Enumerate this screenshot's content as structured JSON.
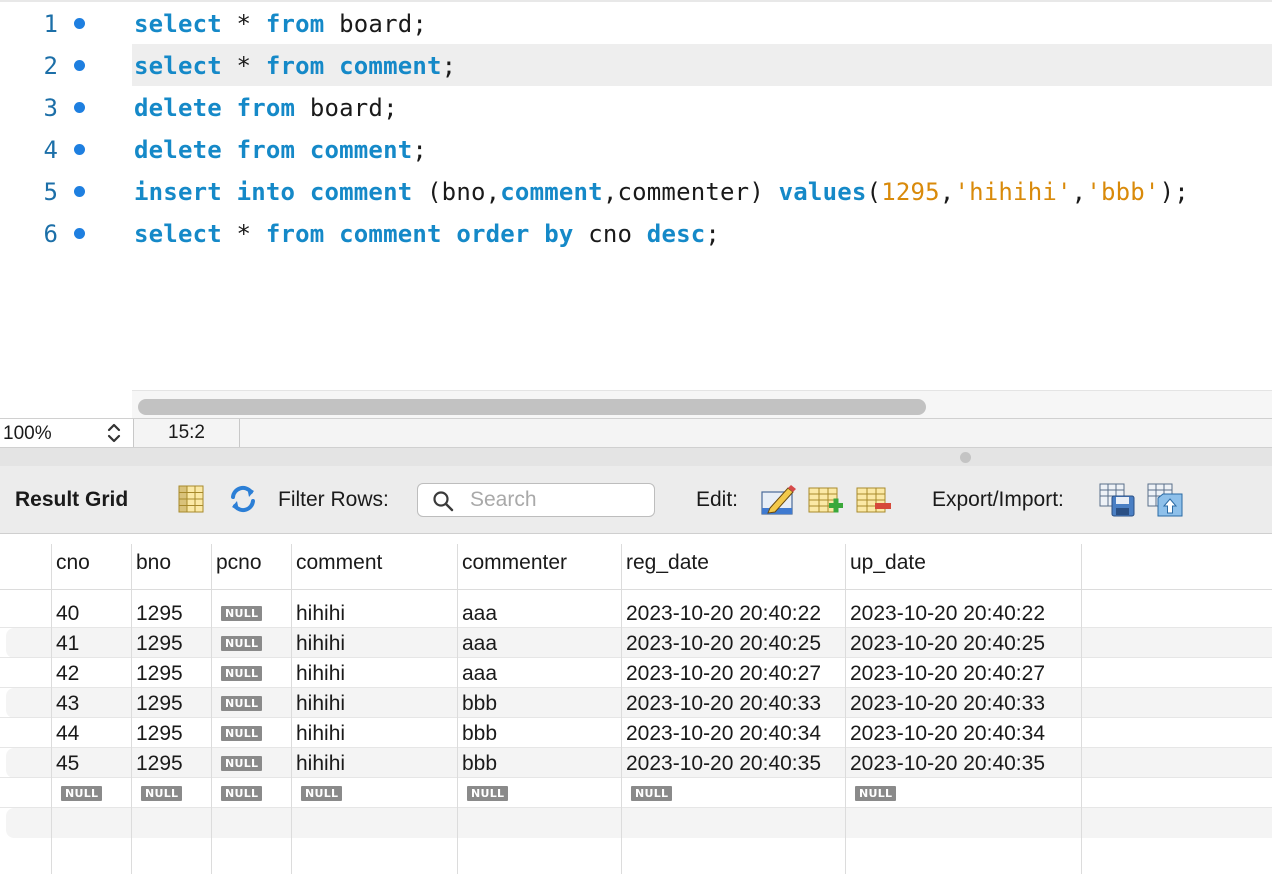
{
  "editor": {
    "lines": [
      {
        "num": "1",
        "tokens": [
          {
            "t": "select",
            "c": "kw"
          },
          {
            "t": " * ",
            "c": ""
          },
          {
            "t": "from",
            "c": "kw"
          },
          {
            "t": " board;",
            "c": ""
          }
        ]
      },
      {
        "num": "2",
        "tokens": [
          {
            "t": "select",
            "c": "kw"
          },
          {
            "t": " * ",
            "c": ""
          },
          {
            "t": "from",
            "c": "kw"
          },
          {
            "t": " ",
            "c": ""
          },
          {
            "t": "comment",
            "c": "kw"
          },
          {
            "t": ";",
            "c": ""
          }
        ]
      },
      {
        "num": "3",
        "tokens": [
          {
            "t": "delete",
            "c": "kw"
          },
          {
            "t": " ",
            "c": ""
          },
          {
            "t": "from",
            "c": "kw"
          },
          {
            "t": " board;",
            "c": ""
          }
        ]
      },
      {
        "num": "4",
        "tokens": [
          {
            "t": "delete",
            "c": "kw"
          },
          {
            "t": " ",
            "c": ""
          },
          {
            "t": "from",
            "c": "kw"
          },
          {
            "t": " ",
            "c": ""
          },
          {
            "t": "comment",
            "c": "kw"
          },
          {
            "t": ";",
            "c": ""
          }
        ]
      },
      {
        "num": "5",
        "tokens": [
          {
            "t": "insert",
            "c": "kw"
          },
          {
            "t": " ",
            "c": ""
          },
          {
            "t": "into",
            "c": "kw"
          },
          {
            "t": " ",
            "c": ""
          },
          {
            "t": "comment",
            "c": "kw"
          },
          {
            "t": " (bno,",
            "c": ""
          },
          {
            "t": "comment",
            "c": "kw"
          },
          {
            "t": ",commenter) ",
            "c": ""
          },
          {
            "t": "values",
            "c": "kw"
          },
          {
            "t": "(",
            "c": ""
          },
          {
            "t": "1295",
            "c": "num"
          },
          {
            "t": ",",
            "c": ""
          },
          {
            "t": "'hihihi'",
            "c": "str"
          },
          {
            "t": ",",
            "c": ""
          },
          {
            "t": "'bbb'",
            "c": "str"
          },
          {
            "t": ");",
            "c": ""
          }
        ]
      },
      {
        "num": "6",
        "tokens": [
          {
            "t": "select",
            "c": "kw"
          },
          {
            "t": " * ",
            "c": ""
          },
          {
            "t": "from",
            "c": "kw"
          },
          {
            "t": " ",
            "c": ""
          },
          {
            "t": "comment",
            "c": "kw"
          },
          {
            "t": " ",
            "c": ""
          },
          {
            "t": "order",
            "c": "kw"
          },
          {
            "t": " ",
            "c": ""
          },
          {
            "t": "by",
            "c": "kw"
          },
          {
            "t": " cno ",
            "c": ""
          },
          {
            "t": "desc",
            "c": "kw"
          },
          {
            "t": ";",
            "c": ""
          }
        ]
      }
    ],
    "current_line": 2,
    "colors": {
      "keyword": "#1589c8",
      "literal": "#d98a0a",
      "line_number": "#1c6fa8",
      "breakpoint_dot": "#1e7fe0"
    }
  },
  "status": {
    "zoom": "100%",
    "cursor_position": "15:2"
  },
  "toolbar": {
    "result_grid_label": "Result Grid",
    "filter_label": "Filter Rows:",
    "search_placeholder": "Search",
    "edit_label": "Edit:",
    "export_label": "Export/Import:",
    "icons": [
      "grid-layout-icon",
      "refresh-icon",
      "search-icon",
      "edit-row-icon",
      "add-row-icon",
      "delete-row-icon",
      "export-icon",
      "import-icon"
    ]
  },
  "grid": {
    "columns": [
      "cno",
      "bno",
      "pcno",
      "comment",
      "commenter",
      "reg_date",
      "up_date"
    ],
    "null_label": "NULL",
    "rows": [
      [
        "40",
        "1295",
        null,
        "hihihi",
        "aaa",
        "2023-10-20 20:40:22",
        "2023-10-20 20:40:22"
      ],
      [
        "41",
        "1295",
        null,
        "hihihi",
        "aaa",
        "2023-10-20 20:40:25",
        "2023-10-20 20:40:25"
      ],
      [
        "42",
        "1295",
        null,
        "hihihi",
        "aaa",
        "2023-10-20 20:40:27",
        "2023-10-20 20:40:27"
      ],
      [
        "43",
        "1295",
        null,
        "hihihi",
        "bbb",
        "2023-10-20 20:40:33",
        "2023-10-20 20:40:33"
      ],
      [
        "44",
        "1295",
        null,
        "hihihi",
        "bbb",
        "2023-10-20 20:40:34",
        "2023-10-20 20:40:34"
      ],
      [
        "45",
        "1295",
        null,
        "hihihi",
        "bbb",
        "2023-10-20 20:40:35",
        "2023-10-20 20:40:35"
      ],
      [
        null,
        null,
        null,
        null,
        null,
        null,
        null
      ]
    ]
  }
}
